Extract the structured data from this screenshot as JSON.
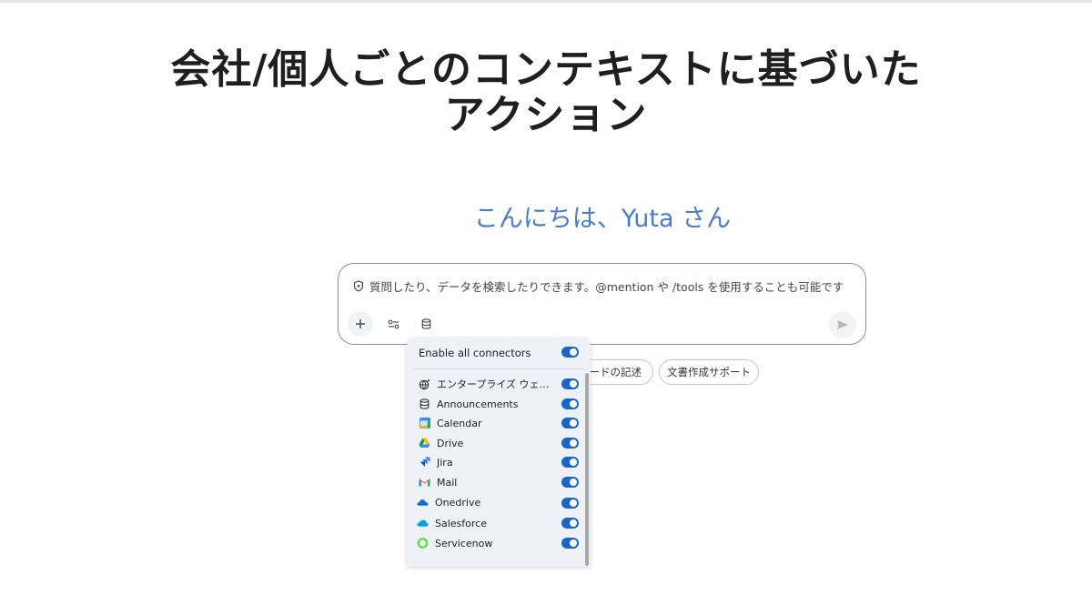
{
  "page": {
    "title_line1": "会社/個人ごとのコンテキストに基づいた",
    "title_line2": "アクション",
    "greeting": "こんにちは、Yuta さん"
  },
  "input": {
    "placeholder": "質問したり、データを検索したりできます。@mention や /tools を使用することも可能です"
  },
  "chips": [
    {
      "label": "ードの記述"
    },
    {
      "label": "文書作成サポート"
    }
  ],
  "connectors": {
    "header_label": "Enable all connectors",
    "header_enabled": true,
    "items": [
      {
        "label": "エンタープライズ ウェブ…",
        "icon": "enterprise-web-icon",
        "enabled": true
      },
      {
        "label": "Announcements",
        "icon": "database-icon",
        "enabled": true
      },
      {
        "label": "Calendar",
        "icon": "calendar-icon",
        "enabled": true
      },
      {
        "label": "Drive",
        "icon": "drive-icon",
        "enabled": true
      },
      {
        "label": "Jira",
        "icon": "jira-icon",
        "enabled": true
      },
      {
        "label": "Mail",
        "icon": "mail-icon",
        "enabled": true
      },
      {
        "label": "Onedrive",
        "icon": "onedrive-icon",
        "enabled": true
      },
      {
        "label": "Salesforce",
        "icon": "salesforce-icon",
        "enabled": true
      },
      {
        "label": "Servicenow",
        "icon": "servicenow-icon",
        "enabled": true
      }
    ]
  },
  "colors": {
    "greeting": "#4b7bc4",
    "toggle_on": "#1a66c6",
    "dropdown_bg": "#eef2f7"
  }
}
